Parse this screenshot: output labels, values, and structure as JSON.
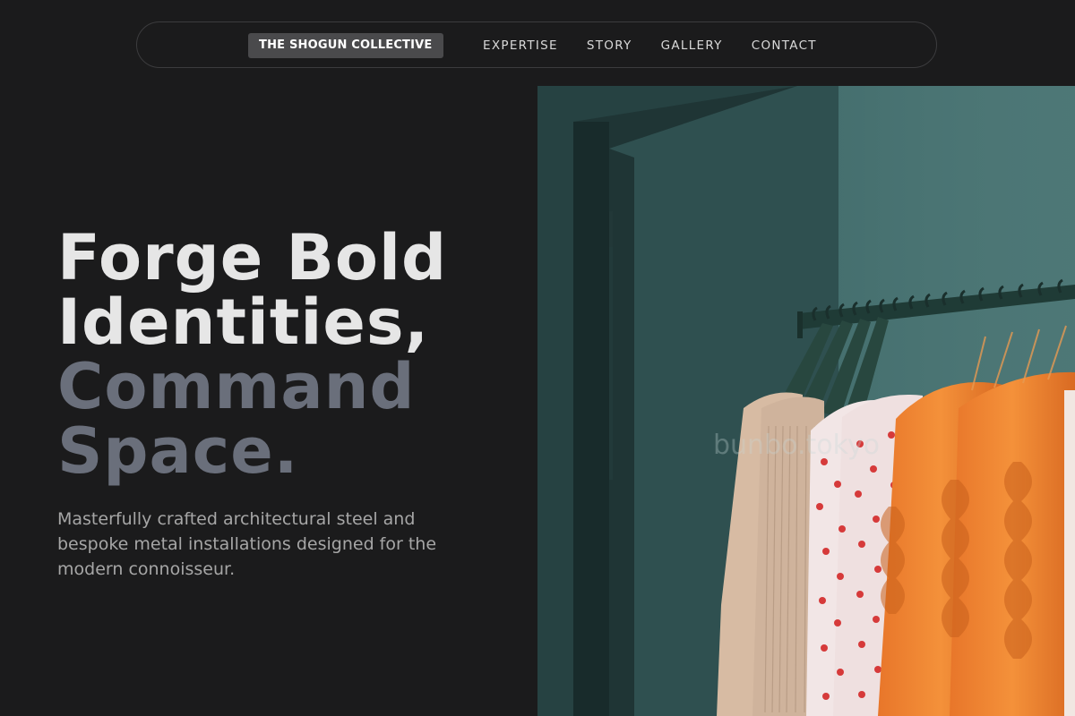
{
  "nav": {
    "brand": "THE SHOGUN COLLECTIVE",
    "links": [
      "EXPERTISE",
      "STORY",
      "GALLERY",
      "CONTACT"
    ]
  },
  "hero": {
    "title_lines": [
      "Forge Bold",
      "Identities,",
      "Command",
      "Space."
    ],
    "subtitle": "Masterfully crafted architectural steel and bespoke metal installations designed for the modern connoisseur.",
    "image_watermark": "bunbo.tokyo"
  },
  "colors": {
    "background": "#1b1b1c",
    "title_light": "#e6e6e6",
    "title_dim": "#6a6f7b",
    "subtitle": "#a6a6a6",
    "brand_badge": "#4a4a4c"
  }
}
